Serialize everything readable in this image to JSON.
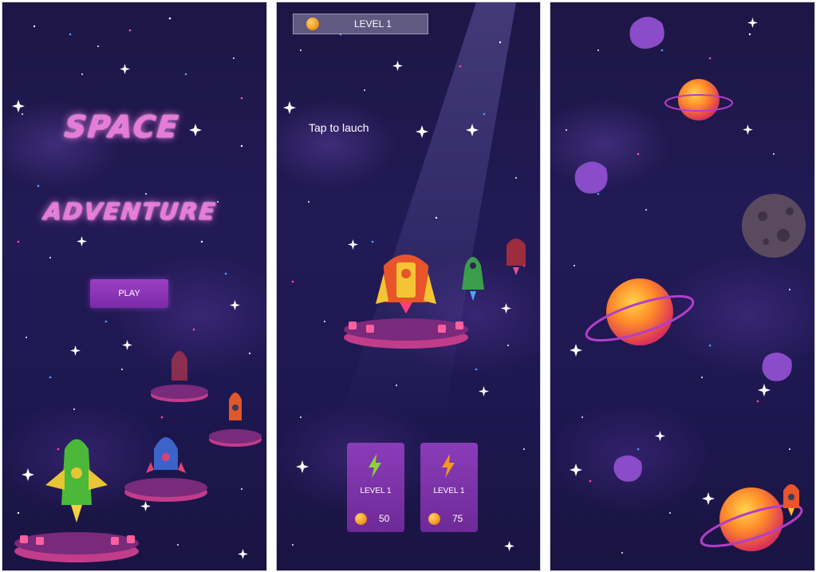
{
  "title_screen": {
    "title_line1": "SPACE",
    "title_line2": "ADVENTURE",
    "play_label": "PLAY"
  },
  "launch_screen": {
    "level_label": "LEVEL 1",
    "hint": "Tap to lauch",
    "cards": [
      {
        "level": "LEVEL 1",
        "price": "50",
        "bolt_color": "#8bd33a"
      },
      {
        "level": "LEVEL 1",
        "price": "75",
        "bolt_color": "#f39a1e"
      }
    ]
  },
  "colors": {
    "background": "#1e1750",
    "accent": "#9b3fc2",
    "title": "#e97ad9",
    "coin": "#f39a1e"
  },
  "icons": [
    "coin-icon",
    "lightning-icon",
    "rocket-icon",
    "planet-icon",
    "asteroid-icon",
    "star-icon"
  ]
}
